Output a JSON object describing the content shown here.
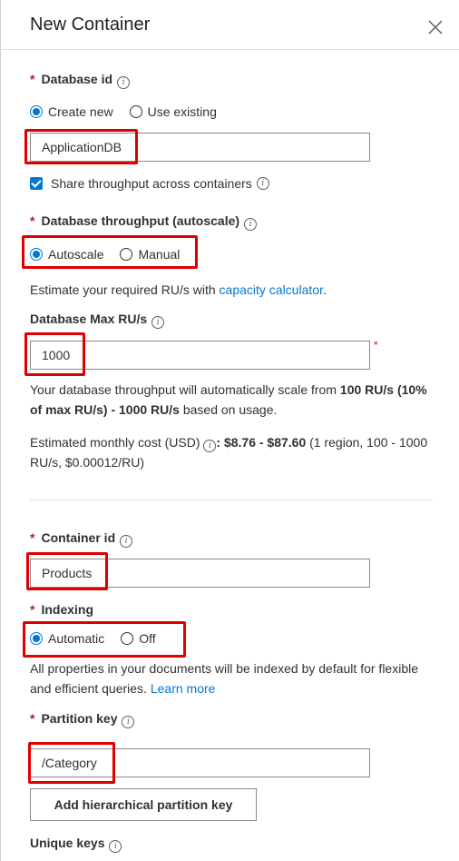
{
  "panel": {
    "title": "New Container"
  },
  "database_id": {
    "label": "Database id",
    "options": [
      "Create new",
      "Use existing"
    ],
    "selected": "Create new",
    "value": "ApplicationDB",
    "share_throughput_label": "Share throughput across containers",
    "share_throughput_checked": true
  },
  "throughput": {
    "label": "Database throughput (autoscale)",
    "options": [
      "Autoscale",
      "Manual"
    ],
    "selected": "Autoscale",
    "estimate_prefix": "Estimate your required RU/s with ",
    "estimate_link": "capacity calculator",
    "estimate_suffix": "."
  },
  "max_ru": {
    "label": "Database Max RU/s",
    "value": "1000",
    "required_mark": "*",
    "desc_1": "Your database throughput will automatically scale from ",
    "desc_bold": "100 RU/s (10% of max RU/s) - 1000 RU/s",
    "desc_2": " based on usage.",
    "cost_prefix": "Estimated monthly cost (USD) ",
    "cost_sep": ": ",
    "cost_bold": "$8.76 - $87.60",
    "cost_suffix": " (1 region, 100 - 1000 RU/s, $0.00012/RU)"
  },
  "container_id": {
    "label": "Container id",
    "value": "Products"
  },
  "indexing": {
    "label": "Indexing",
    "options": [
      "Automatic",
      "Off"
    ],
    "selected": "Automatic",
    "desc": "All properties in your documents will be indexed by default for flexible and efficient queries. ",
    "learn_more": "Learn more"
  },
  "partition_key": {
    "label": "Partition key",
    "value": "/Category",
    "add_button": "Add hierarchical partition key"
  },
  "unique_keys": {
    "label": "Unique keys"
  },
  "icons": {
    "info": "info-icon",
    "close": "close-icon"
  },
  "colors": {
    "accent": "#0078d4",
    "required": "#a4262c",
    "highlight": "#e00000"
  }
}
